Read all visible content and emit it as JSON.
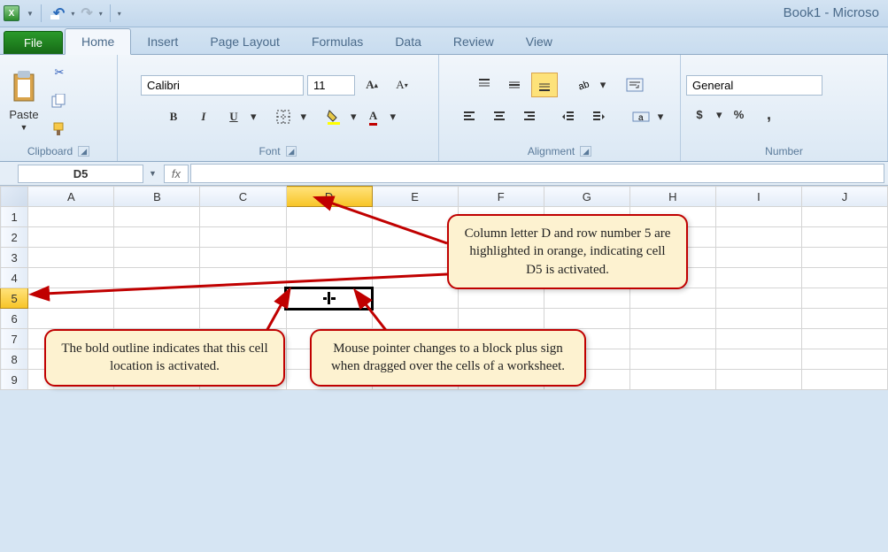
{
  "window": {
    "title": "Book1 - Microso"
  },
  "tabs": {
    "file": "File",
    "home": "Home",
    "insert": "Insert",
    "page_layout": "Page Layout",
    "formulas": "Formulas",
    "data": "Data",
    "review": "Review",
    "view": "View"
  },
  "ribbon": {
    "clipboard": {
      "label": "Clipboard",
      "paste": "Paste"
    },
    "font": {
      "label": "Font",
      "name": "Calibri",
      "size": "11",
      "bold": "B",
      "italic": "I",
      "underline": "U"
    },
    "alignment": {
      "label": "Alignment"
    },
    "number": {
      "label": "Number",
      "format": "General",
      "currency": "$",
      "percent": "%",
      "comma": ","
    }
  },
  "formula_bar": {
    "namebox": "D5",
    "fx": "fx"
  },
  "grid": {
    "cols": [
      "A",
      "B",
      "C",
      "D",
      "E",
      "F",
      "G",
      "H",
      "I",
      "J"
    ],
    "rows": [
      "1",
      "2",
      "3",
      "4",
      "5",
      "6",
      "7",
      "8",
      "9"
    ],
    "active_col": "D",
    "active_row": "5"
  },
  "callouts": {
    "c1": "Column letter D and row number 5 are highlighted in orange, indicating cell D5 is activated.",
    "c2": "The bold outline indicates that this cell location is activated.",
    "c3": "Mouse pointer changes to a block plus sign when dragged over the cells of a worksheet."
  }
}
